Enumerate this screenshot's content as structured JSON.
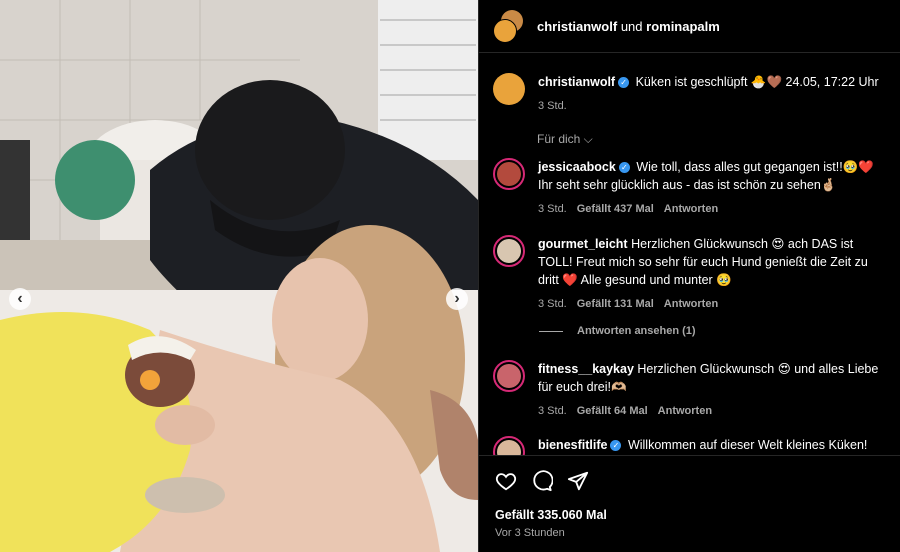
{
  "header": {
    "user1": "christianwolf",
    "connector": "und",
    "user2": "rominapalm"
  },
  "caption": {
    "username": "christianwolf",
    "text": "Küken ist geschlüpft 🐣🤎 24.05, 17:22 Uhr",
    "age": "3 Std."
  },
  "for_you_label": "Für dich ⌵",
  "comments": [
    {
      "username": "jessicaabock",
      "verified": true,
      "text": "Wie toll, dass alles gut gegangen ist!!🥹❤️ Ihr seht sehr glücklich aus - das ist schön zu sehen🤞🏼",
      "age": "3 Std.",
      "likes": "Gefällt 437 Mal",
      "reply": "Antworten"
    },
    {
      "username": "gourmet_leicht",
      "verified": false,
      "text": "Herzlichen Glückwunsch 😍 ach DAS ist TOLL! Freut mich so sehr für euch Hund genießt die Zeit zu dritt ❤️ Alle gesund und munter 🥹",
      "age": "3 Std.",
      "likes": "Gefällt 131 Mal",
      "reply": "Antworten"
    },
    {
      "username": "fitness__kaykay",
      "verified": false,
      "text": "Herzlichen Glückwunsch 😍 und alles Liebe für euch drei!🫶🏼",
      "age": "3 Std.",
      "likes": "Gefällt 64 Mal",
      "reply": "Antworten"
    },
    {
      "username": "bienesfitlife",
      "verified": true,
      "text": "Willkommen auf dieser Welt kleines Küken!",
      "age": "",
      "likes": "",
      "reply": ""
    }
  ],
  "view_replies": "Antworten ansehen (1)",
  "footer": {
    "likes": "Gefällt 335.060 Mal",
    "time": "Vor 3 Stunden"
  },
  "icons": {
    "like": "heart-icon",
    "comment": "comment-icon",
    "share": "share-icon",
    "verified": "verified-badge-icon",
    "prev": "chevron-left-icon",
    "next": "chevron-right-icon"
  },
  "colors": {
    "background": "#000000",
    "verified": "#3897f0",
    "muted": "#a8a8a8",
    "divider": "#262626"
  }
}
